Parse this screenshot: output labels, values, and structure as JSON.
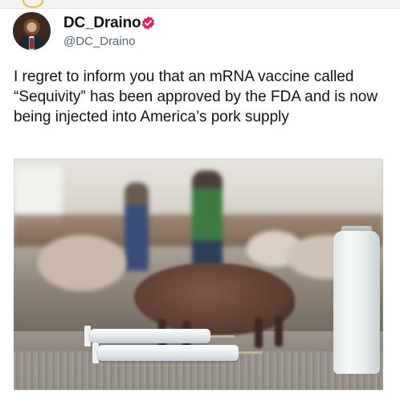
{
  "tweet": {
    "author": {
      "display_name": "DC_Draino",
      "handle": "@DC_Draino",
      "verified": true,
      "verified_color": "#e0245e"
    },
    "text": "I regret to inform you that an mRNA vaccine called “Sequivity” has been approved by the FDA and is now being injected into America’s pork supply",
    "media": {
      "icon": "photo-icon"
    }
  }
}
